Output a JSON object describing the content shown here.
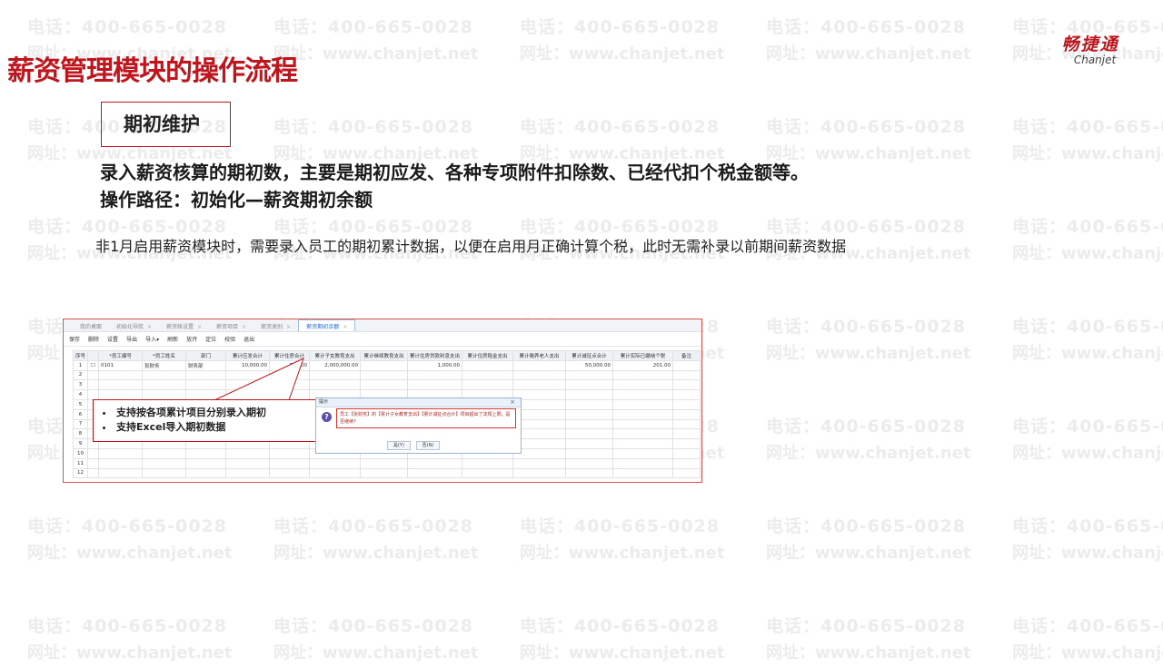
{
  "watermark": {
    "phone": "电话：400-665-0028",
    "site": "网址：www.chanjet.net"
  },
  "slide": {
    "title": "薪资管理模块的操作流程",
    "logo_cn": "畅捷通",
    "logo_en": "Chanjet",
    "section_label": "期初维护",
    "desc_line1": "录入薪资核算的期初数，主要是期初应发、各种专项附件扣除数、已经代扣个税金额等。",
    "desc_line2": "操作路径：初始化—薪资期初余额",
    "note": "非1月启用薪资模块时，需要录入员工的期初累计数据，以便在启用月正确计算个税，此时无需补录以前期间薪资数据"
  },
  "screenshot": {
    "tabs": [
      {
        "label": "我的桌面",
        "active": false
      },
      {
        "label": "初始化导航",
        "active": false
      },
      {
        "label": "薪资帐设置",
        "active": false
      },
      {
        "label": "薪资项目",
        "active": false
      },
      {
        "label": "薪资类别",
        "active": false
      },
      {
        "label": "薪资期初余额",
        "active": true
      }
    ],
    "tab_close": "×",
    "toolbar": [
      "保存",
      "删除",
      "设置",
      "导出",
      "导入▾",
      "刷新",
      "放开",
      "定位",
      "校验",
      "退出"
    ],
    "columns": [
      "序号",
      "",
      "*员工编号",
      "*员工姓名",
      "部门",
      "累计应发合计",
      "累计住房合计",
      "累计子女教育支出",
      "累计继续教育支出",
      "累计住房贷款利息支出",
      "累计住房租金支出",
      "累计赡养老人支出",
      "累计减征点合计",
      "累计实际已缴纳个税",
      "备注"
    ],
    "row1": {
      "seq": "1",
      "checkbox": "☐",
      "emp_no": "0101",
      "emp_name": "张财务",
      "dept": "财务部",
      "gross": "10,000.00",
      "housing": "500.00",
      "child_edu": "2,000,000.00",
      "cont_edu": "",
      "loan_interest": "1,000.00",
      "rent": "",
      "elderly": "",
      "deduction": "50,000.00",
      "tax_paid": "201.00",
      "remark": ""
    },
    "row_numbers": [
      "2",
      "3",
      "4",
      "5",
      "6",
      "7",
      "8",
      "9",
      "10",
      "11",
      "12"
    ]
  },
  "callout": {
    "bullet1": "支持按各项累计项目分别录入期初",
    "bullet2": "支持Excel导入期初数据"
  },
  "dialog": {
    "title": "提示",
    "close": "×",
    "icon": "?",
    "message": "员工【张财务】的【累计子女教育支出】【累计减征点合计】项目超出了法规上限，是否继续?",
    "yes": "是(Y)",
    "no": "否(N)"
  }
}
